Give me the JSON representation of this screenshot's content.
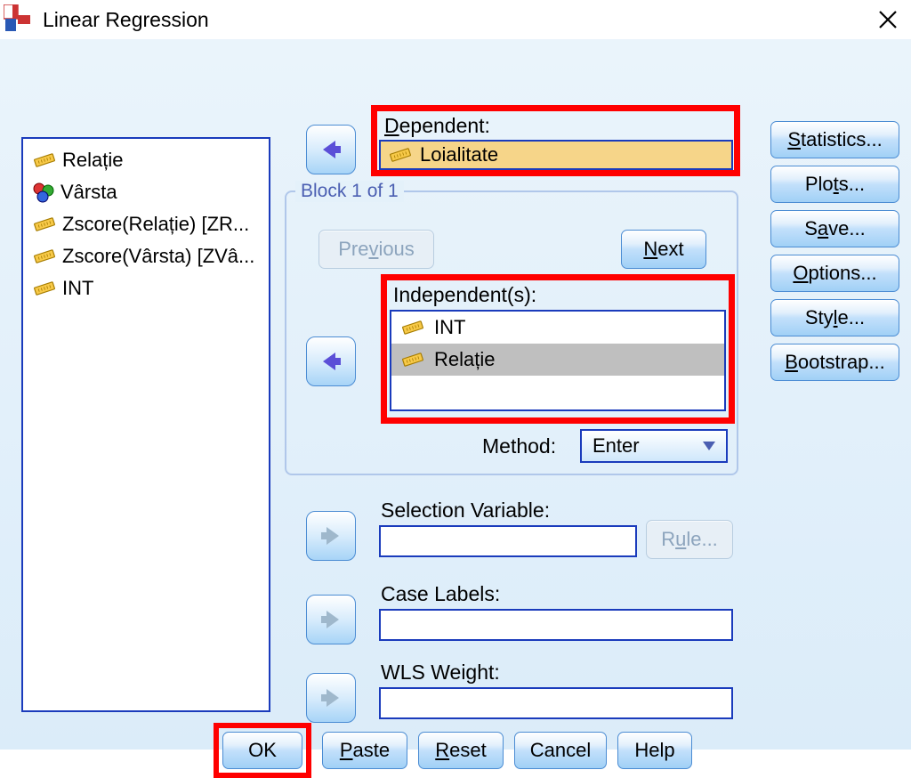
{
  "window": {
    "title": "Linear Regression"
  },
  "sourceVars": [
    {
      "label": "Relație",
      "icon": "scale"
    },
    {
      "label": "Vârsta",
      "icon": "nominal"
    },
    {
      "label": "Zscore(Relație) [ZR...",
      "icon": "scale"
    },
    {
      "label": "Zscore(Vârsta) [ZVâ...",
      "icon": "scale"
    },
    {
      "label": "INT",
      "icon": "scale"
    }
  ],
  "dependent": {
    "label": "Dependent:",
    "value": "Loialitate"
  },
  "block": {
    "legend": "Block 1 of 1",
    "previous": "Previous",
    "next": "Next",
    "independents_label": "Independent(s):",
    "independents": [
      {
        "label": "INT",
        "selected": false
      },
      {
        "label": "Relație",
        "selected": true
      }
    ],
    "method_label": "Method:",
    "method_value": "Enter"
  },
  "selectionVar": {
    "label": "Selection Variable:",
    "value": "",
    "rule": "Rule..."
  },
  "caseLabels": {
    "label": "Case Labels:",
    "value": ""
  },
  "wlsWeight": {
    "label": "WLS Weight:",
    "value": ""
  },
  "sideButtons": {
    "statistics": "Statistics...",
    "plots": "Plots...",
    "save": "Save...",
    "options": "Options...",
    "style": "Style...",
    "bootstrap": "Bootstrap..."
  },
  "bottomButtons": {
    "ok": "OK",
    "paste": "Paste",
    "reset": "Reset",
    "cancel": "Cancel",
    "help": "Help"
  }
}
